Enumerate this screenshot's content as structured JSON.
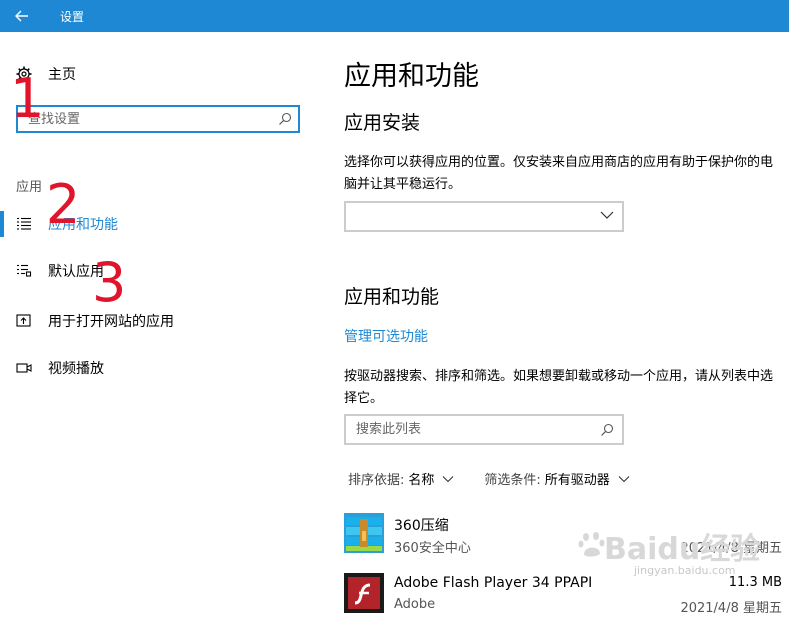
{
  "titlebar": {
    "title": "设置"
  },
  "sidebar": {
    "home_label": "主页",
    "search_placeholder": "查找设置",
    "section_label": "应用",
    "items": [
      {
        "label": "应用和功能",
        "icon": "list-icon",
        "active": true
      },
      {
        "label": "默认应用",
        "icon": "default-apps-icon",
        "active": false
      },
      {
        "label": "用于打开网站的应用",
        "icon": "open-website-icon",
        "active": false
      },
      {
        "label": "视频播放",
        "icon": "video-icon",
        "active": false
      }
    ]
  },
  "annotations": [
    "1",
    "2",
    "3"
  ],
  "main": {
    "title": "应用和功能",
    "install_heading": "应用安装",
    "install_desc": "选择你可以获得应用的位置。仅安装来自应用商店的应用有助于保护你的电脑并让其平稳运行。",
    "install_select_value": "",
    "apps_heading": "应用和功能",
    "optional_features_link": "管理可选功能",
    "apps_desc": "按驱动器搜索、排序和筛选。如果想要卸载或移动一个应用，请从列表中选择它。",
    "list_search_placeholder": "搜索此列表",
    "sort_label": "排序依据:",
    "sort_value": "名称",
    "filter_label": "筛选条件:",
    "filter_value": "所有驱动器",
    "apps": [
      {
        "name": "360压缩",
        "publisher": "360安全中心",
        "size": "",
        "date": "2021/4/8 星期五"
      },
      {
        "name": "Adobe Flash Player 34 PPAPI",
        "publisher": "Adobe",
        "size": "11.3 MB",
        "date": "2021/4/8 星期五"
      }
    ]
  },
  "watermark": {
    "main": "Baidu经验",
    "sub": "jingyan.baidu.com"
  },
  "colors": {
    "accent": "#1f88d4",
    "annotation": "#e0142a"
  }
}
